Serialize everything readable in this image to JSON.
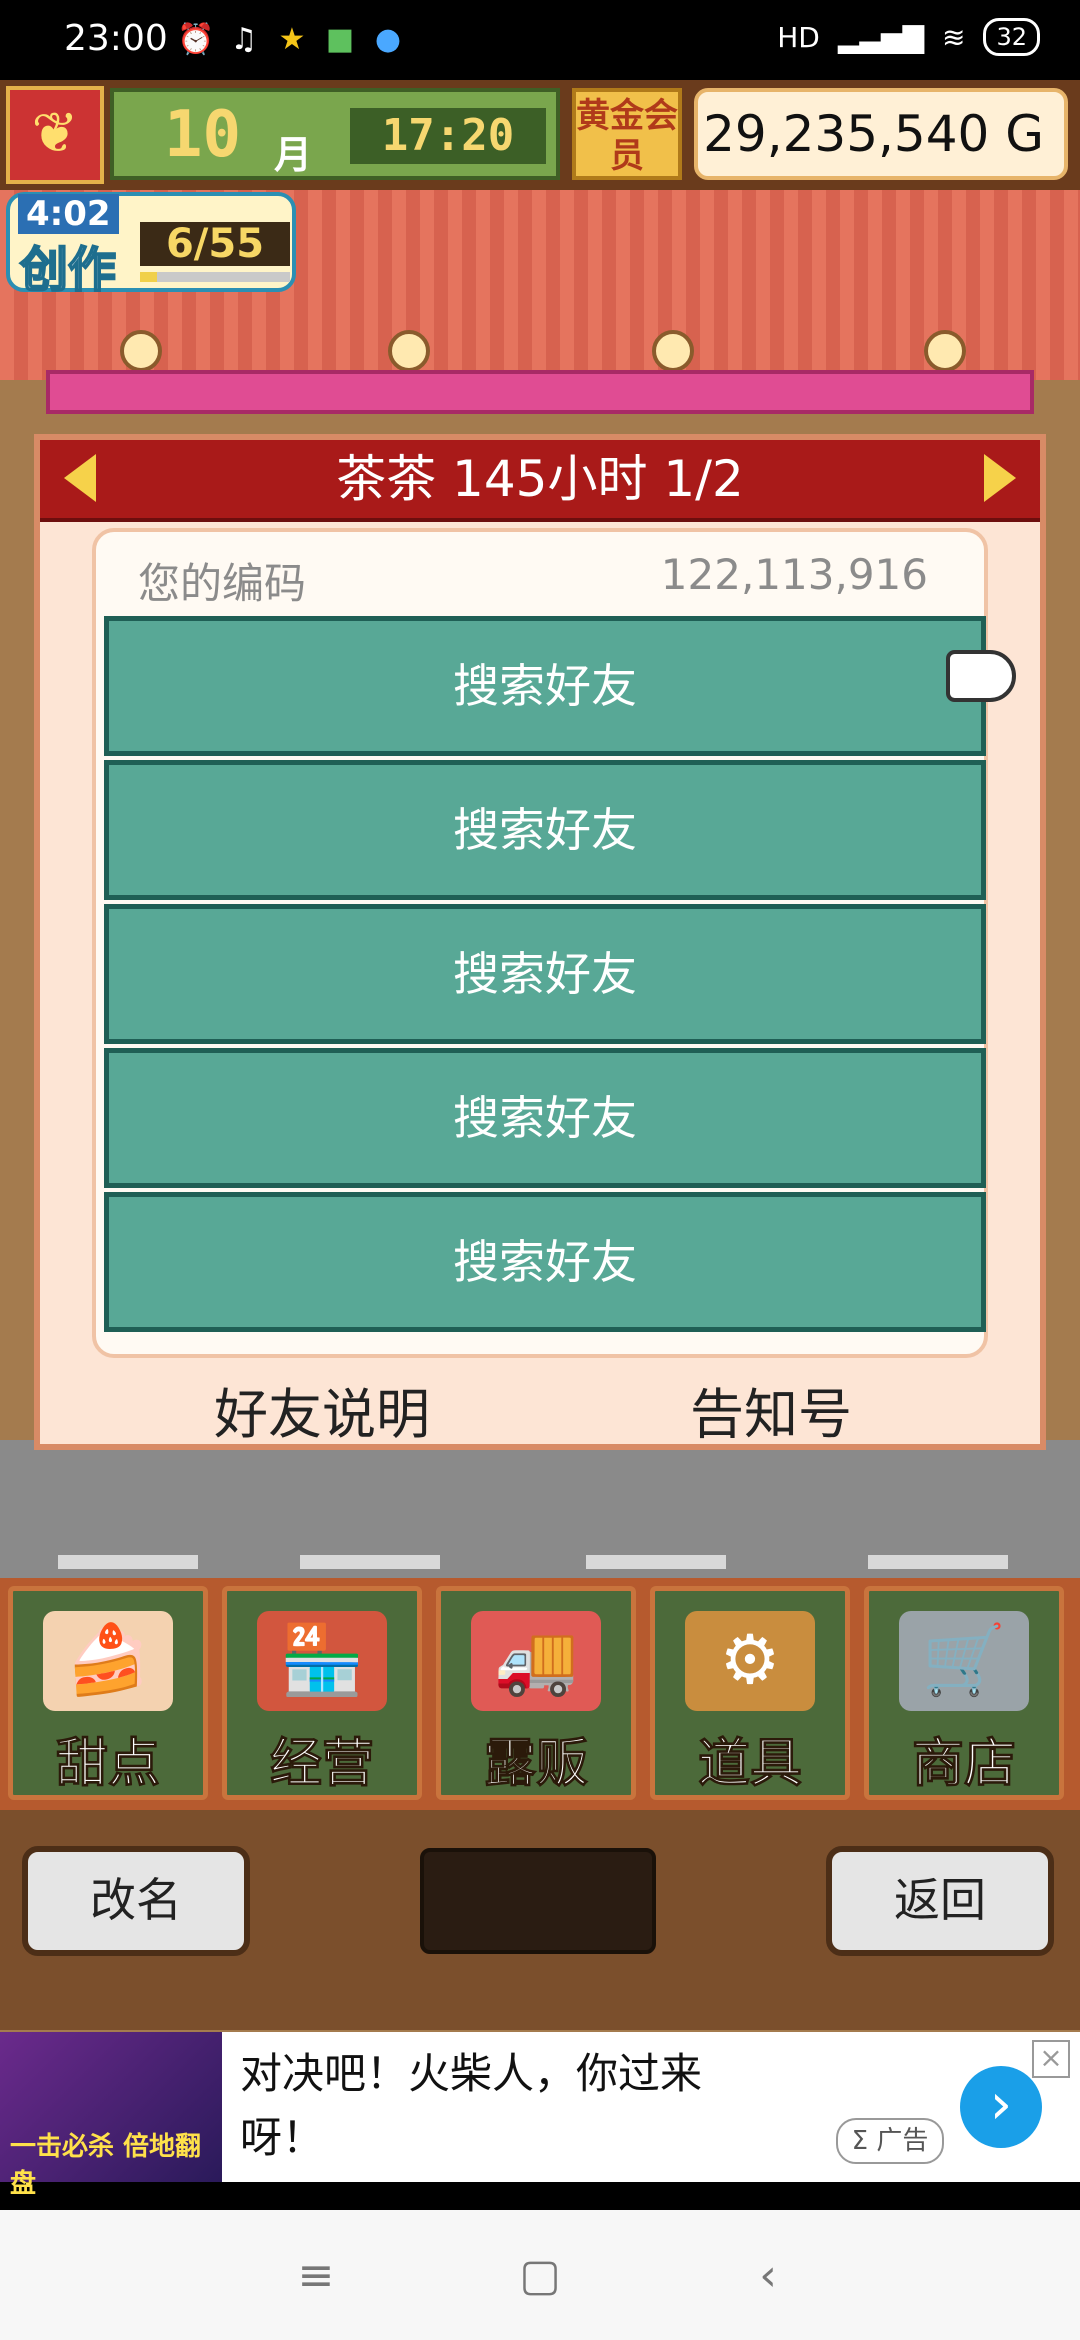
{
  "status_bar": {
    "time": "23:00",
    "icons": [
      "alarm-icon",
      "headphones-icon",
      "star-icon",
      "app-icon",
      "qq-icon"
    ],
    "right": {
      "hd": "HD",
      "signal": "signal-icon",
      "wifi": "wifi-icon",
      "battery": "32"
    }
  },
  "hud": {
    "month_number": "10",
    "month_label": "月",
    "clock": "17:20",
    "gold_member": "黄金会员",
    "money": "29,235,540 G"
  },
  "creation": {
    "timer": "4:02",
    "label": "创作",
    "count": "6/55",
    "progress": 0.11
  },
  "dialog": {
    "title": "茶茶 145小时 1/2",
    "code_label": "您的编码",
    "code_value": "122,113,916",
    "search_buttons": [
      "搜索好友",
      "搜索好友",
      "搜索好友",
      "搜索好友",
      "搜索好友"
    ],
    "footer_left": "好友说明",
    "footer_right": "告知号"
  },
  "menu": [
    {
      "label": "甜点",
      "icon": "cake-icon"
    },
    {
      "label": "经营",
      "icon": "shop-icon"
    },
    {
      "label": "露贩",
      "icon": "food-truck-icon"
    },
    {
      "label": "道具",
      "icon": "items-bag-icon"
    },
    {
      "label": "商店",
      "icon": "shopping-cart-icon"
    }
  ],
  "controls": {
    "rename": "改名",
    "back": "返回"
  },
  "ad": {
    "image_text": "一击必杀 倍地翻盘",
    "text": "对决吧！火柴人，你过来呀！",
    "tag": "Σ 广告",
    "close": "×"
  },
  "colors": {
    "title_bar": "#a91a19",
    "search_button": "#58a896",
    "dialog_bg": "#fde5d5"
  }
}
